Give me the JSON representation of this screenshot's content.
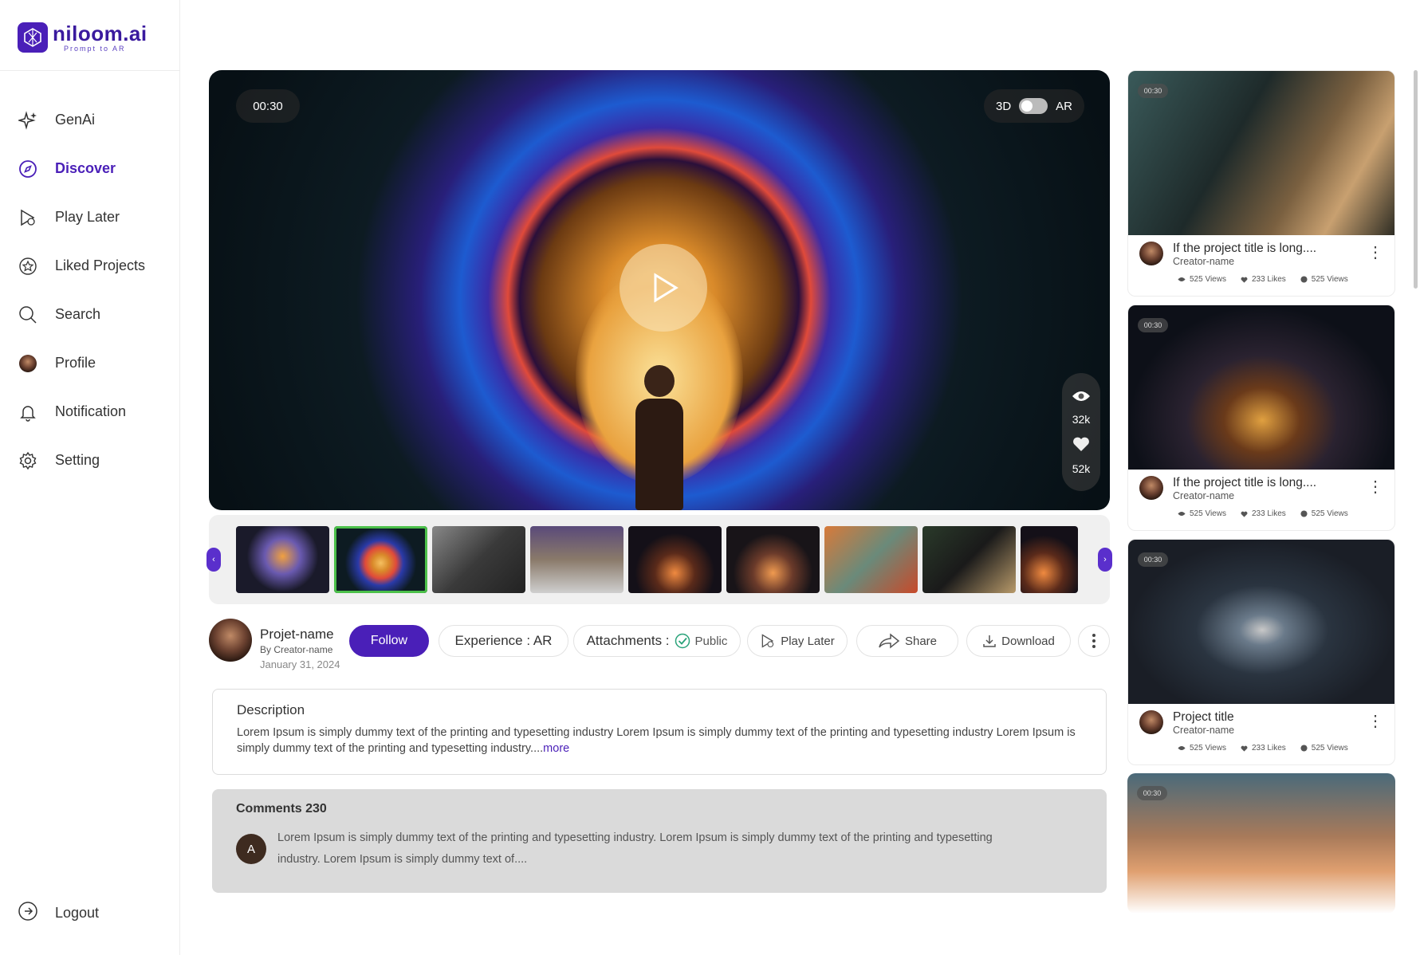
{
  "brand": {
    "name": "niloom.ai",
    "tagline": "Prompt to AR"
  },
  "nav": [
    {
      "label": "GenAi",
      "icon": "sparkle-icon",
      "active": false
    },
    {
      "label": "Discover",
      "icon": "compass-icon",
      "active": true
    },
    {
      "label": "Play Later",
      "icon": "play-later-icon",
      "active": false
    },
    {
      "label": "Liked Projects",
      "icon": "star-badge-icon",
      "active": false
    },
    {
      "label": "Search",
      "icon": "search-icon",
      "active": false
    },
    {
      "label": "Profile",
      "icon": "avatar",
      "active": false
    },
    {
      "label": "Notification",
      "icon": "bell-icon",
      "active": false
    },
    {
      "label": "Setting",
      "icon": "gear-icon",
      "active": false
    }
  ],
  "logout": "Logout",
  "player": {
    "timer": "00:30",
    "mode_left": "3D",
    "mode_right": "AR",
    "views": "32k",
    "likes": "52k"
  },
  "project": {
    "name": "Projet-name",
    "by": "By Creator-name",
    "date": "January 31, 2024",
    "follow": "Follow",
    "experience": "Experience : AR",
    "attachments": "Attachments :",
    "visibility": "Public",
    "play_later": "Play Later",
    "share": "Share",
    "download": "Download"
  },
  "description": {
    "title": "Description",
    "text": "Lorem Ipsum is simply dummy text of the printing and  typesetting industry Lorem Ipsum is simply dummy text of the printing and  typesetting industry Lorem Ipsum is simply dummy text of the printing and typesetting industry....",
    "more": "more"
  },
  "comments": {
    "title": "Comments 230",
    "avatar_letter": "A",
    "text": "Lorem Ipsum is simply dummy text of the printing and typesetting industry. Lorem Ipsum is simply dummy text of the printing and typesetting industry. Lorem Ipsum is simply dummy text of...."
  },
  "cards": [
    {
      "time": "00:30",
      "title": "If the project title is long....",
      "creator": "Creator-name",
      "views": "525 Views",
      "likes": "233 Likes",
      "views2": "525 Views"
    },
    {
      "time": "00:30",
      "title": "If the project title is long....",
      "creator": "Creator-name",
      "views": "525 Views",
      "likes": "233 Likes",
      "views2": "525 Views"
    },
    {
      "time": "00:30",
      "title": "Project title",
      "creator": "Creator-name",
      "views": "525 Views",
      "likes": "233 Likes",
      "views2": "525 Views"
    },
    {
      "time": "00:30"
    }
  ],
  "colors": {
    "accent": "#4a1fb8",
    "selected_thumb": "#4cc04a"
  }
}
